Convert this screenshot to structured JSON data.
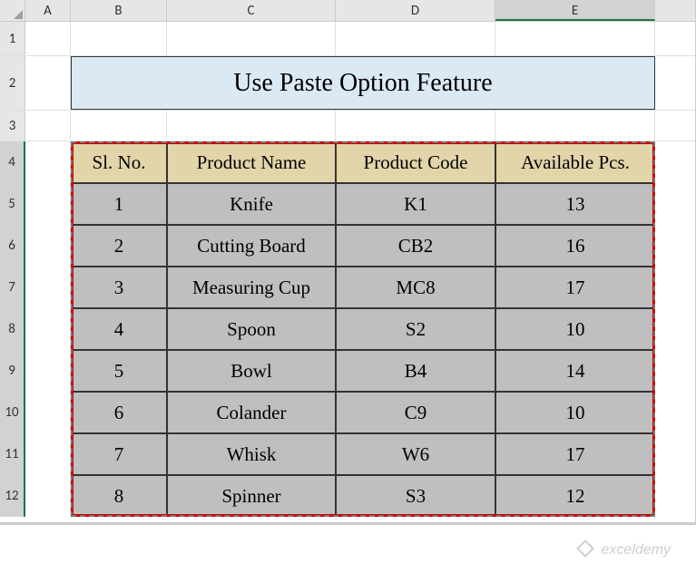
{
  "columns": {
    "a": "A",
    "b": "B",
    "c": "C",
    "d": "D",
    "e": "E"
  },
  "row_labels": {
    "r1": "1",
    "r2": "2",
    "r3": "3",
    "r4": "4",
    "r5": "5",
    "r6": "6",
    "r7": "7",
    "r8": "8",
    "r9": "9",
    "r10": "10",
    "r11": "11",
    "r12": "12"
  },
  "title": "Use Paste Option Feature",
  "headers": {
    "sl": "Sl. No.",
    "name": "Product Name",
    "code": "Product Code",
    "pcs": "Available Pcs."
  },
  "chart_data": {
    "type": "table",
    "title": "Use Paste Option Feature",
    "columns": [
      "Sl. No.",
      "Product Name",
      "Product Code",
      "Available Pcs."
    ],
    "rows": [
      {
        "sl": "1",
        "name": "Knife",
        "code": "K1",
        "pcs": "13"
      },
      {
        "sl": "2",
        "name": "Cutting Board",
        "code": "CB2",
        "pcs": "16"
      },
      {
        "sl": "3",
        "name": "Measuring Cup",
        "code": "MC8",
        "pcs": "17"
      },
      {
        "sl": "4",
        "name": "Spoon",
        "code": "S2",
        "pcs": "10"
      },
      {
        "sl": "5",
        "name": "Bowl",
        "code": "B4",
        "pcs": "14"
      },
      {
        "sl": "6",
        "name": "Colander",
        "code": "C9",
        "pcs": "10"
      },
      {
        "sl": "7",
        "name": "Whisk",
        "code": "W6",
        "pcs": "17"
      },
      {
        "sl": "8",
        "name": "Spinner",
        "code": "S3",
        "pcs": "12"
      }
    ]
  },
  "watermark": "exceldemy"
}
